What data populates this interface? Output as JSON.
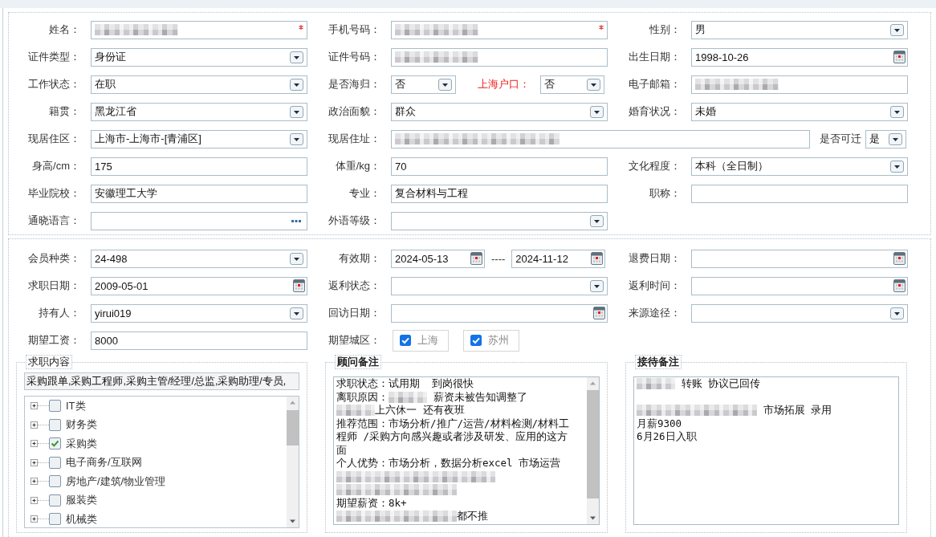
{
  "sections": [
    {
      "rows": [
        [
          {
            "label": "姓名：",
            "kind": "text",
            "redacted": true,
            "required": true
          },
          {
            "label": "手机号码：",
            "kind": "text",
            "redacted": true,
            "required": true
          },
          {
            "label": "性别：",
            "kind": "select",
            "value": "男",
            "redacted": false,
            "required": false
          }
        ],
        [
          {
            "label": "证件类型：",
            "kind": "select",
            "value": "身份证",
            "redacted": false,
            "required": false
          },
          {
            "label": "证件号码：",
            "kind": "text",
            "redacted": true,
            "required": false
          },
          {
            "label": "出生日期：",
            "kind": "date",
            "value": "1998-10-26",
            "redacted": false,
            "required": false
          }
        ],
        [
          {
            "label": "工作状态：",
            "kind": "select",
            "value": "在职",
            "redacted": false,
            "required": false
          },
          {
            "label": "是否海归：",
            "kind": "select",
            "value": "否",
            "redacted": false,
            "required": false,
            "attached": {
              "label": "上海户口：",
              "kind": "select",
              "value": "否",
              "emphasized": true
            }
          },
          {
            "label": "电子邮箱：",
            "kind": "text",
            "redacted": true,
            "required": false
          }
        ],
        [
          {
            "label": "籍贯：",
            "kind": "select",
            "value": "黑龙江省",
            "redacted": false,
            "required": false
          },
          {
            "label": "政治面貌：",
            "kind": "select",
            "value": "群众",
            "redacted": false,
            "required": false
          },
          {
            "label": "婚育状况：",
            "kind": "select",
            "value": "未婚",
            "redacted": false,
            "required": false
          }
        ],
        [
          {
            "label": "现居住区：",
            "kind": "select",
            "value": "上海市-上海市-[青浦区]",
            "redacted": false,
            "required": false
          },
          {
            "label": "现居住址：",
            "kind": "longtext",
            "redacted": true,
            "required": false,
            "attached": {
              "label": "是否可迁",
              "kind": "select",
              "value": "是",
              "emphasized": false
            }
          }
        ],
        [
          {
            "label": "身高/cm：",
            "kind": "text",
            "value": "175",
            "redacted": false,
            "required": false
          },
          {
            "label": "体重/kg：",
            "kind": "text",
            "value": "70",
            "redacted": false,
            "required": false
          },
          {
            "label": "文化程度：",
            "kind": "select",
            "value": "本科（全日制）",
            "redacted": false,
            "required": false
          }
        ],
        [
          {
            "label": "毕业院校：",
            "kind": "text",
            "value": "安徽理工大学",
            "redacted": false,
            "required": false
          },
          {
            "label": "专业：",
            "kind": "text",
            "value": "复合材料与工程",
            "redacted": false,
            "required": false
          },
          {
            "label": "职称：",
            "kind": "text",
            "redacted": false,
            "required": false
          }
        ],
        [
          {
            "label": "通晓语言：",
            "kind": "picker",
            "redacted": false,
            "required": false
          },
          {
            "label": "外语等级：",
            "kind": "select",
            "redacted": false,
            "required": false
          }
        ]
      ]
    },
    {
      "rows": [
        [
          {
            "label": "会员种类：",
            "kind": "select",
            "value": "24-498",
            "redacted": false,
            "required": false
          },
          {
            "label": "有效期：",
            "kind": "daterange",
            "value": "2024-05-13",
            "separator": "----",
            "value_end": "2024-11-12",
            "redacted": false,
            "required": false
          },
          {
            "label": "退费日期：",
            "kind": "date",
            "redacted": false,
            "required": false
          }
        ],
        [
          {
            "label": "求职日期：",
            "kind": "date",
            "value": "2009-05-01",
            "redacted": false,
            "required": false
          },
          {
            "label": "返利状态：",
            "kind": "select",
            "redacted": false,
            "required": false
          },
          {
            "label": "返利时间：",
            "kind": "date",
            "redacted": false,
            "required": false
          }
        ],
        [
          {
            "label": "持有人：",
            "kind": "select",
            "value": "yirui019",
            "redacted": false,
            "required": false
          },
          {
            "label": "回访日期：",
            "kind": "date",
            "redacted": false,
            "required": false
          },
          {
            "label": "来源途径：",
            "kind": "select",
            "redacted": false,
            "required": false
          }
        ],
        [
          {
            "label": "期望工资：",
            "kind": "text",
            "value": "8000",
            "redacted": false,
            "required": false
          },
          {
            "label": "期望城区：",
            "kind": "checks",
            "options": [
              {
                "label": "上海",
                "checked": true
              },
              {
                "label": "苏州",
                "checked": true
              }
            ]
          }
        ]
      ]
    }
  ],
  "panels": [
    {
      "kind": "tree",
      "title": "求职内容",
      "summary": "采购跟单,采购工程师,采购主管/经理/总监,采购助理/专员,",
      "items": [
        {
          "label": "IT类",
          "checked": false,
          "expanded": false
        },
        {
          "label": "财务类",
          "checked": false,
          "expanded": false
        },
        {
          "label": "采购类",
          "checked": true,
          "expanded": false
        },
        {
          "label": "电子商务/互联网",
          "checked": false,
          "expanded": false
        },
        {
          "label": "房地产/建筑/物业管理",
          "checked": false,
          "expanded": false
        },
        {
          "label": "服装类",
          "checked": false,
          "expanded": false
        },
        {
          "label": "机械类",
          "checked": false,
          "expanded": false
        }
      ]
    },
    {
      "kind": "notes",
      "title": "顾问备注",
      "lines": [
        {
          "kind": "content",
          "parts": [
            {
              "kind": "text",
              "text": "求职状态：试用期  到岗很快"
            }
          ]
        },
        {
          "kind": "content",
          "parts": [
            {
              "kind": "text",
              "text": "离职原因："
            },
            {
              "kind": "blur"
            },
            {
              "kind": "text",
              "text": " 薪资未被告知调整了"
            }
          ]
        },
        {
          "kind": "content",
          "parts": [
            {
              "kind": "blur"
            },
            {
              "kind": "text",
              "text": "上六休一 还有夜班"
            }
          ]
        },
        {
          "kind": "content",
          "parts": [
            {
              "kind": "text",
              "text": "推荐范围：市场分析/推广/运营/材料检测/材料工"
            }
          ]
        },
        {
          "kind": "content",
          "parts": [
            {
              "kind": "text",
              "text": "程师 /采购方向感兴趣或者涉及研发、应用的这方"
            }
          ]
        },
        {
          "kind": "content",
          "parts": [
            {
              "kind": "text",
              "text": "面"
            }
          ]
        },
        {
          "kind": "content",
          "parts": [
            {
              "kind": "text",
              "text": "个人优势：市场分析，数据分析excel 市场运营"
            }
          ]
        },
        {
          "kind": "content",
          "parts": [
            {
              "kind": "blur"
            },
            {
              "kind": "wideblur"
            }
          ]
        },
        {
          "kind": "content",
          "parts": [
            {
              "kind": "wideblur"
            }
          ]
        },
        {
          "kind": "content",
          "parts": [
            {
              "kind": "text",
              "text": "期望薪资：8k+"
            }
          ]
        },
        {
          "kind": "content",
          "parts": [
            {
              "kind": "wideblur"
            },
            {
              "kind": "text",
              "text": "都不推"
            }
          ]
        }
      ]
    },
    {
      "kind": "notes",
      "title": "接待备注",
      "lines": [
        {
          "kind": "content",
          "parts": [
            {
              "kind": "blur"
            },
            {
              "kind": "text",
              "text": " 转账 协议已回传"
            }
          ]
        },
        {
          "kind": "blank"
        },
        {
          "kind": "content",
          "parts": [
            {
              "kind": "wideblur"
            },
            {
              "kind": "text",
              "text": " 市场拓展 录用"
            }
          ]
        },
        {
          "kind": "content",
          "parts": [
            {
              "kind": "text",
              "text": "月薪9300"
            }
          ]
        },
        {
          "kind": "content",
          "parts": [
            {
              "kind": "text",
              "text": "6月26日入职"
            }
          ]
        }
      ]
    }
  ]
}
